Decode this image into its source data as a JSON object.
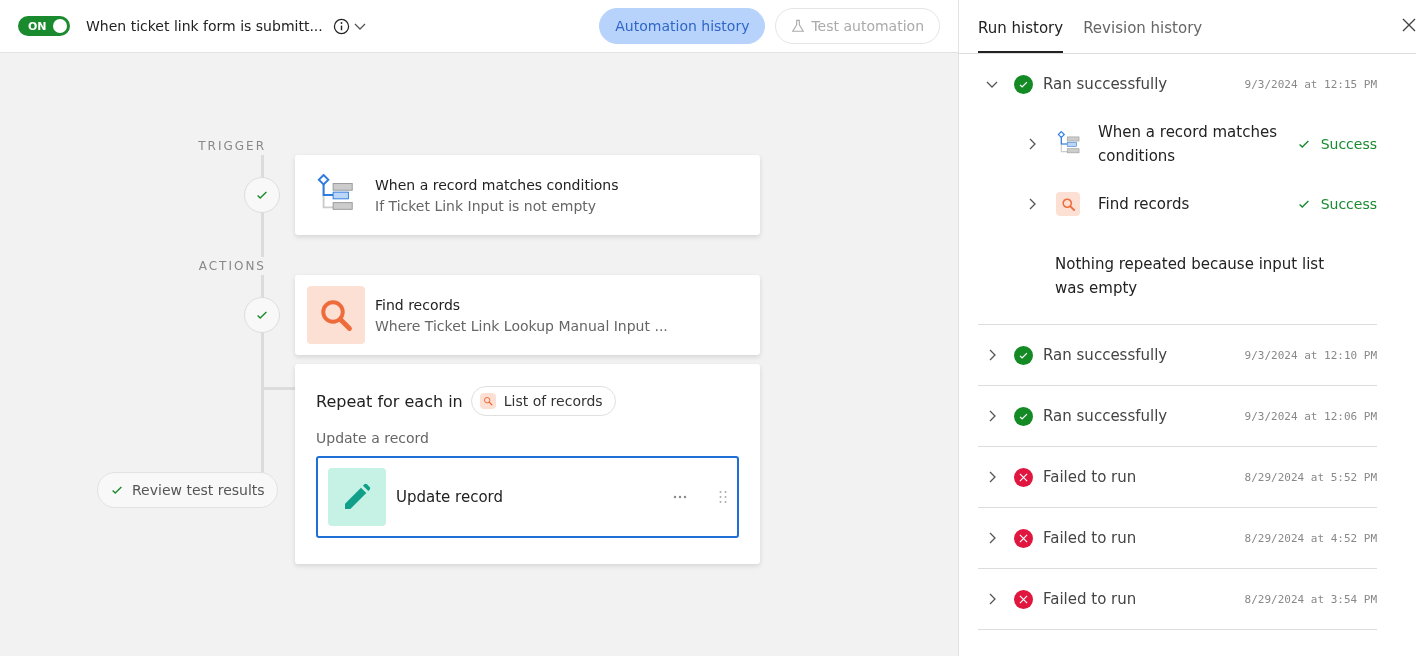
{
  "header": {
    "toggle": {
      "label": "ON",
      "on": true
    },
    "title": "When ticket link form is submitt...",
    "buttons": [
      {
        "label": "Automation history",
        "selected": true,
        "disabled": false
      },
      {
        "label": "Test automation",
        "selected": false,
        "disabled": true
      }
    ]
  },
  "flow": {
    "trigger_label": "TRIGGER",
    "trigger": {
      "title": "When a record matches conditions",
      "subtitle": "If Ticket Link Input is not empty",
      "done": true
    },
    "actions_label": "ACTIONS",
    "actions": [
      {
        "title": "Find records",
        "subtitle": "Where Ticket Link Lookup Manual Input ...",
        "done": true
      }
    ],
    "repeat": {
      "title": "Repeat for each in",
      "source": "List of records",
      "caption": "Update a record",
      "step": {
        "title": "Update record",
        "selected": true
      }
    },
    "review_button": "Review test results"
  },
  "panel": {
    "tabs": [
      {
        "label": "Run history",
        "selected": true
      },
      {
        "label": "Revision history",
        "selected": false
      }
    ],
    "runs": [
      {
        "kind": "success",
        "label": "Ran successfully",
        "time": "9/3/2024 at 12:15 PM",
        "expanded": true,
        "steps": [
          {
            "kind": "trigger",
            "title": "When a record matches conditions",
            "result": "Success"
          },
          {
            "kind": "find",
            "title": "Find records",
            "result": "Success"
          }
        ],
        "note": "Nothing repeated because input list was empty"
      },
      {
        "kind": "success",
        "label": "Ran successfully",
        "time": "9/3/2024 at 12:10 PM",
        "expanded": false
      },
      {
        "kind": "success",
        "label": "Ran successfully",
        "time": "9/3/2024 at 12:06 PM",
        "expanded": false
      },
      {
        "kind": "failed",
        "label": "Failed to run",
        "time": "8/29/2024 at 5:52 PM",
        "expanded": false
      },
      {
        "kind": "failed",
        "label": "Failed to run",
        "time": "8/29/2024 at 4:52 PM",
        "expanded": false
      },
      {
        "kind": "failed",
        "label": "Failed to run",
        "time": "8/29/2024 at 3:54 PM",
        "expanded": false
      }
    ]
  }
}
